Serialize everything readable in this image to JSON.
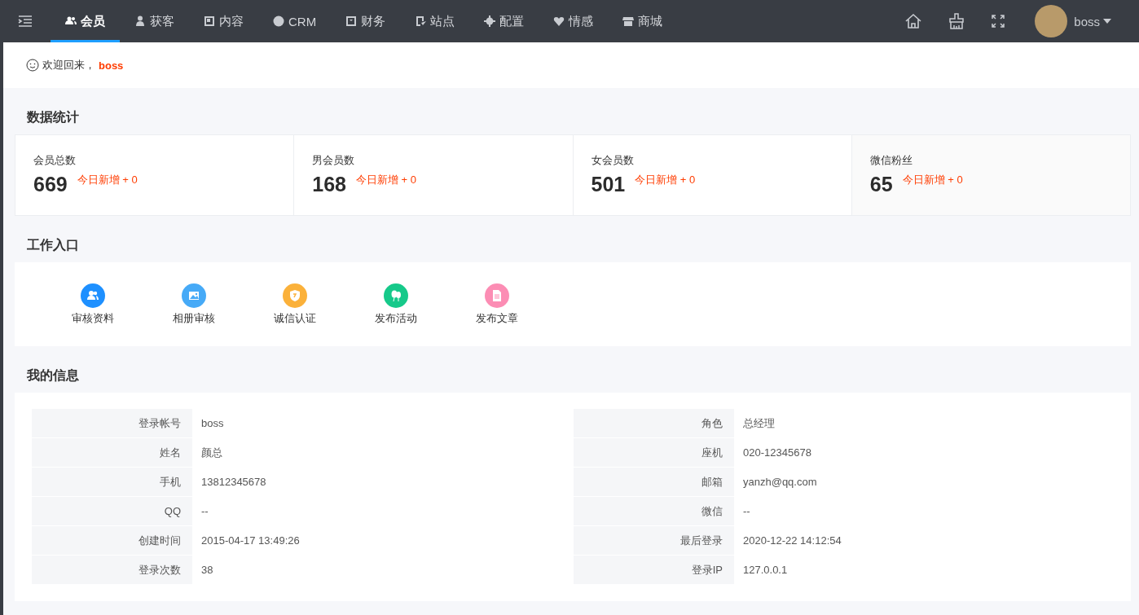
{
  "nav": {
    "tabs": [
      {
        "label": "会员",
        "selected": true
      },
      {
        "label": "获客",
        "selected": false
      },
      {
        "label": "内容",
        "selected": false
      },
      {
        "label": "CRM",
        "selected": false
      },
      {
        "label": "财务",
        "selected": false
      },
      {
        "label": "站点",
        "selected": false
      },
      {
        "label": "配置",
        "selected": false
      },
      {
        "label": "情感",
        "selected": false
      },
      {
        "label": "商城",
        "selected": false
      }
    ],
    "user": "boss"
  },
  "welcome": {
    "text": "欢迎回来，",
    "user": "boss"
  },
  "stats": {
    "title": "数据统计",
    "cards": [
      {
        "label": "会员总数",
        "value": "669",
        "today": "今日新增 + 0"
      },
      {
        "label": "男会员数",
        "value": "168",
        "today": "今日新增 + 0"
      },
      {
        "label": "女会员数",
        "value": "501",
        "today": "今日新增 + 0"
      },
      {
        "label": "微信粉丝",
        "value": "65",
        "today": "今日新增 + 0"
      }
    ]
  },
  "work": {
    "title": "工作入口",
    "items": [
      {
        "label": "审核资料",
        "color": "#1e90ff"
      },
      {
        "label": "相册审核",
        "color": "#46aaf7"
      },
      {
        "label": "诚信认证",
        "color": "#fbb13a"
      },
      {
        "label": "发布活动",
        "color": "#16c98a"
      },
      {
        "label": "发布文章",
        "color": "#fc8db4"
      }
    ]
  },
  "info": {
    "title": "我的信息",
    "fields": [
      {
        "label": "登录帐号",
        "value": "boss"
      },
      {
        "label": "角色",
        "value": "总经理"
      },
      {
        "label": "姓名",
        "value": "颜总"
      },
      {
        "label": "座机",
        "value": "020-12345678"
      },
      {
        "label": "手机",
        "value": "13812345678"
      },
      {
        "label": "邮箱",
        "value": "yanzh@qq.com"
      },
      {
        "label": "QQ",
        "value": "--"
      },
      {
        "label": "微信",
        "value": "--"
      },
      {
        "label": "创建时间",
        "value": "2015-04-17 13:49:26"
      },
      {
        "label": "最后登录",
        "value": "2020-12-22 14:12:54"
      },
      {
        "label": "登录次数",
        "value": "38"
      },
      {
        "label": "登录IP",
        "value": "127.0.0.1"
      }
    ]
  }
}
